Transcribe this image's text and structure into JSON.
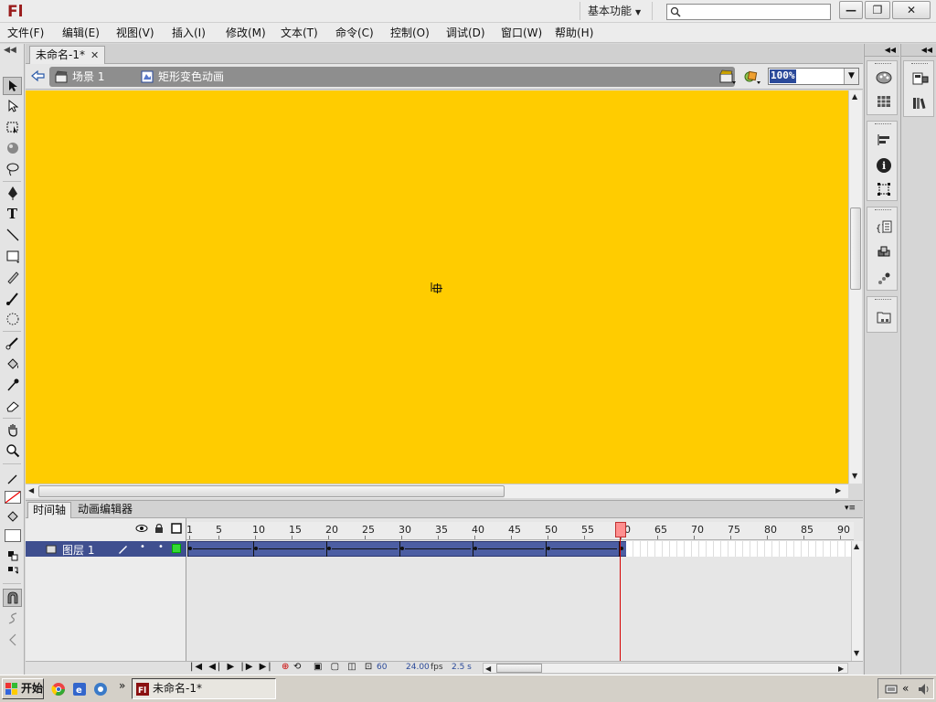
{
  "app": {
    "logo": "Fl"
  },
  "titlebar": {
    "workspace": "基本功能",
    "search_placeholder": "",
    "buttons": {
      "minimize": "—",
      "restore": "❐",
      "close": "✕"
    }
  },
  "menu": [
    "文件(F)",
    "编辑(E)",
    "视图(V)",
    "插入(I)",
    "修改(M)",
    "文本(T)",
    "命令(C)",
    "控制(O)",
    "调试(D)",
    "窗口(W)",
    "帮助(H)"
  ],
  "document": {
    "tab_title": "未命名-1*",
    "scene": "场景 1",
    "symbol": "矩形变色动画",
    "zoom": "100%",
    "stage_color": "#ffcc00"
  },
  "timeline": {
    "tabs": [
      "时间轴",
      "动画编辑器"
    ],
    "layer_name": "图层 1",
    "ruler_labels": [
      "1",
      "5",
      "10",
      "15",
      "20",
      "25",
      "30",
      "35",
      "40",
      "45",
      "50",
      "55",
      "60",
      "65",
      "70",
      "75",
      "80",
      "85",
      "90"
    ],
    "keyframes": [
      1,
      10,
      20,
      30,
      40,
      50,
      60
    ],
    "current_frame": "60",
    "fps": "24.00",
    "fps_unit": "fps",
    "elapsed": "2.5 s"
  },
  "taskbar": {
    "start_label": "开始",
    "task_title": "未命名-1*"
  }
}
